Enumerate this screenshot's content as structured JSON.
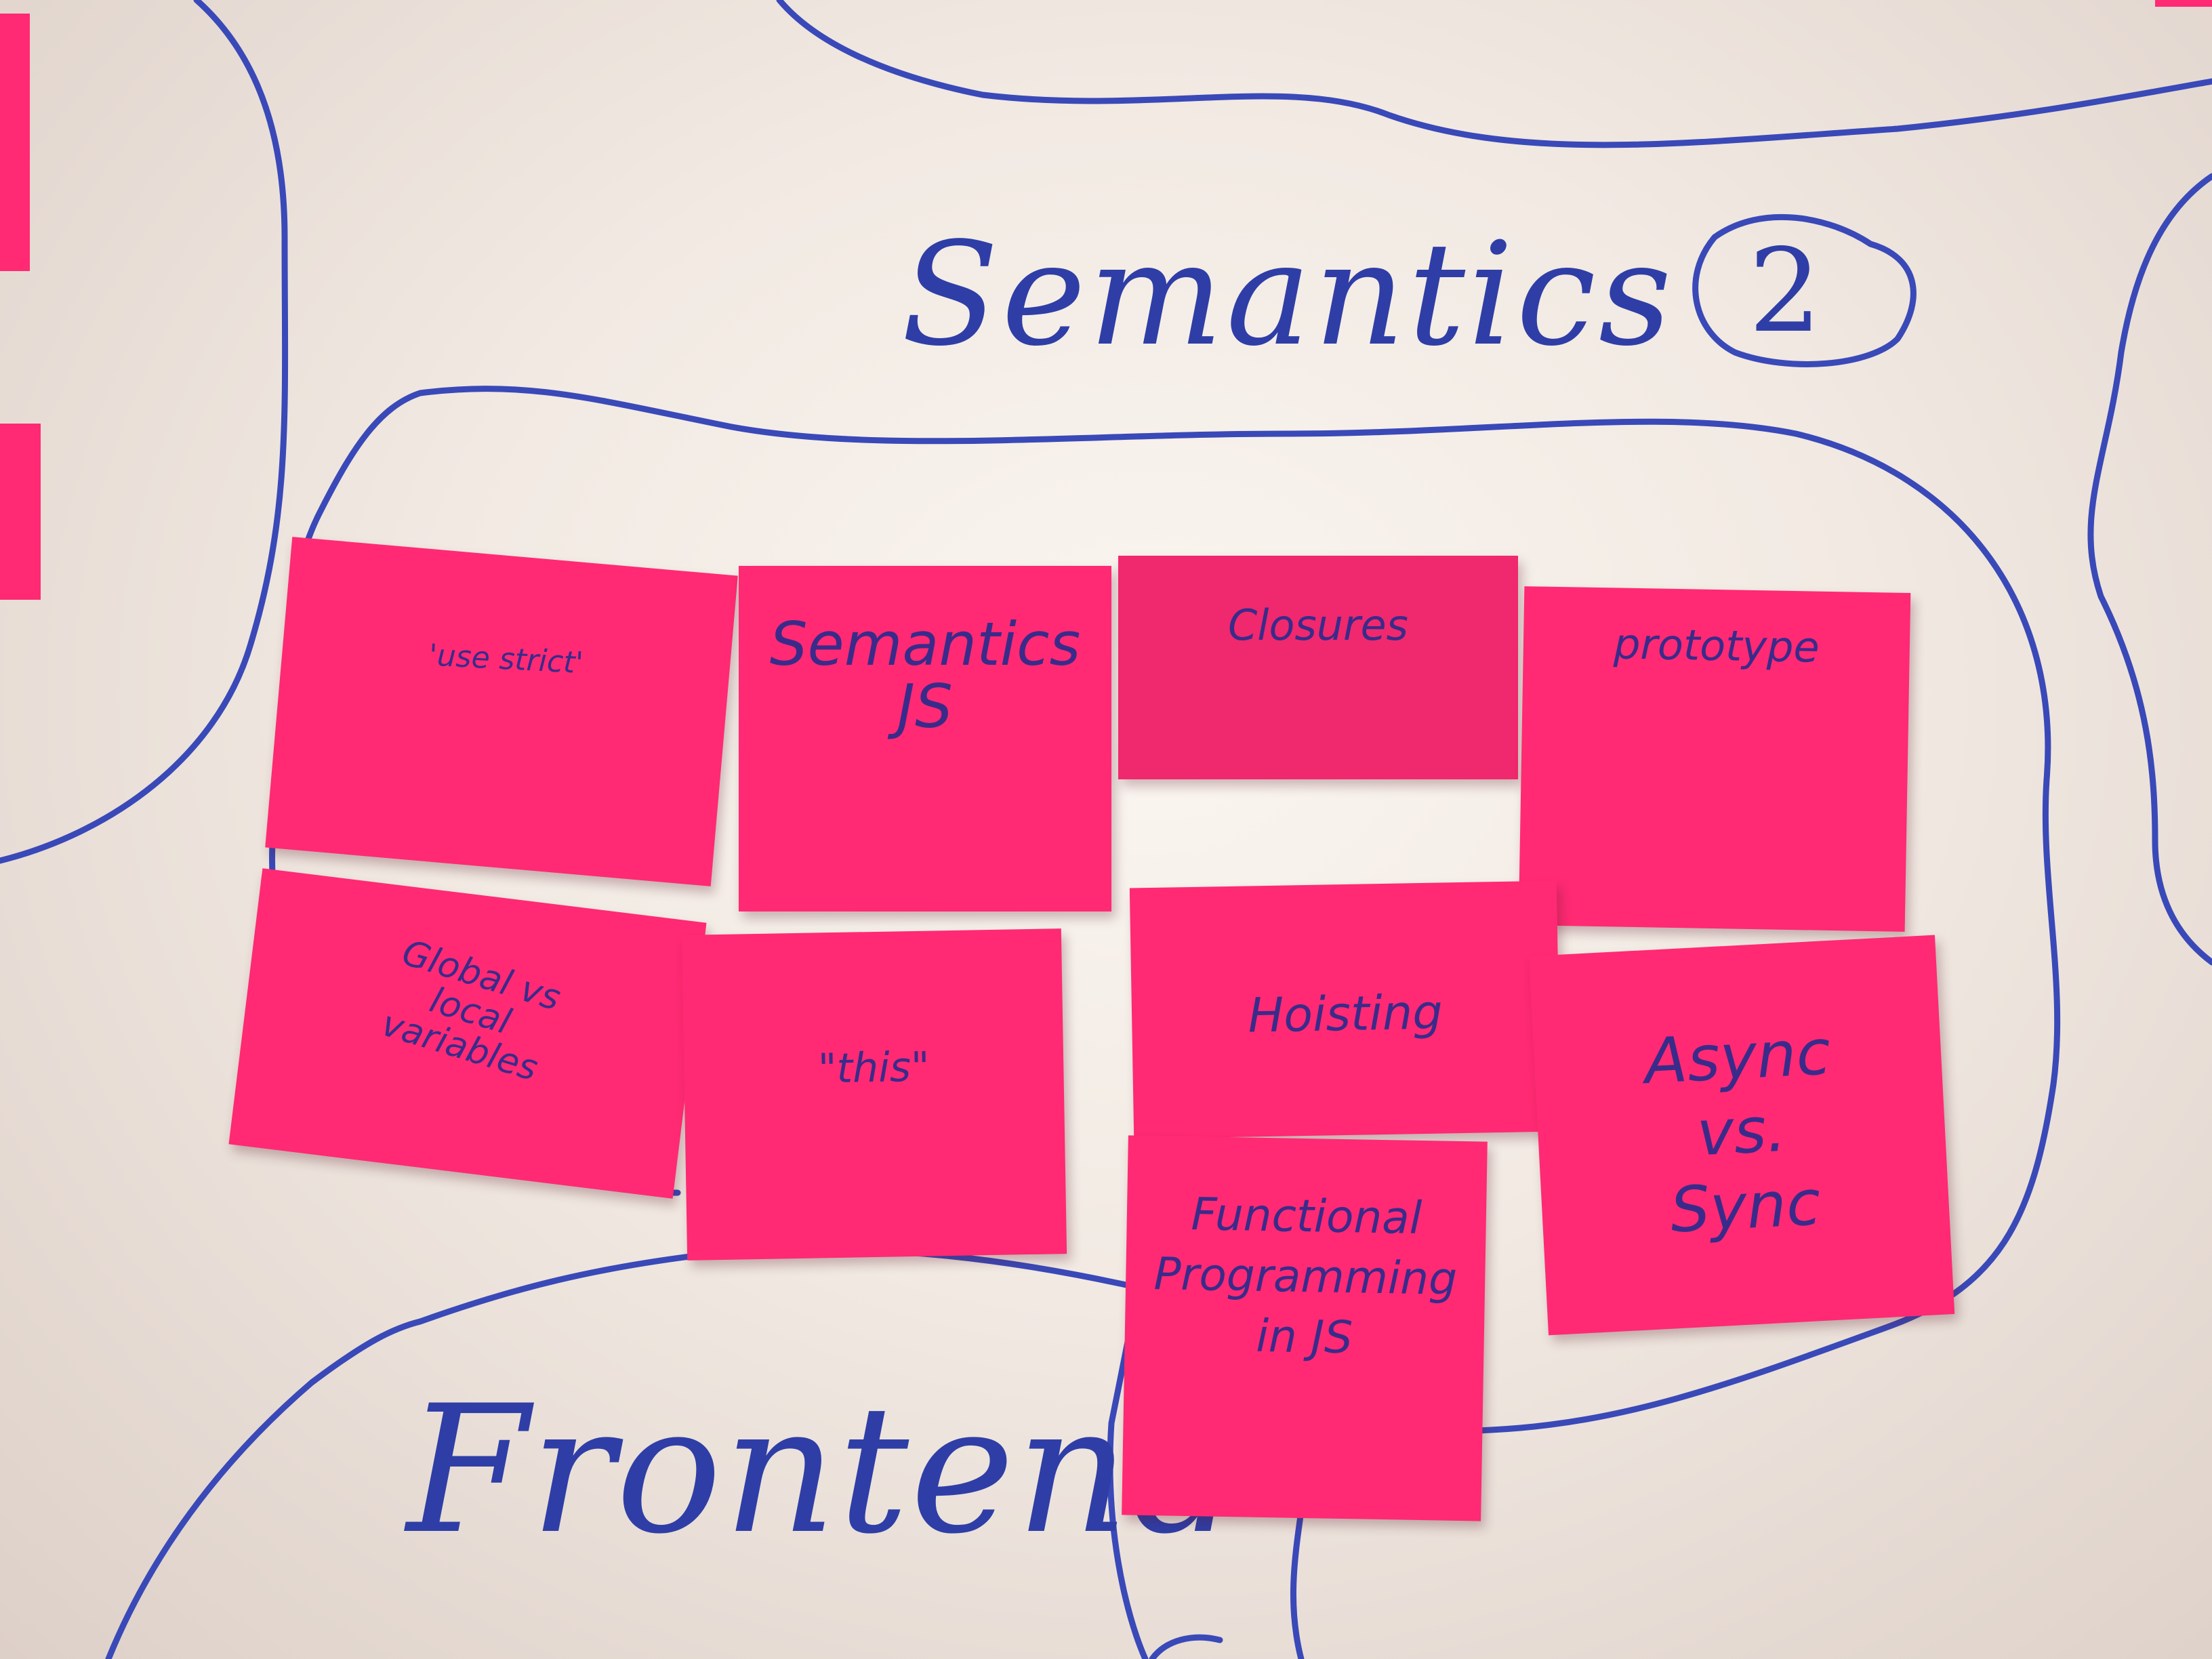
{
  "board": {
    "heading": "Semantics",
    "heading_badge": "2",
    "lower_heading": "Frontend",
    "ink_color": "#3a49b8",
    "note_color": "#ff2a73"
  },
  "notes": [
    {
      "text": "'use strict'"
    },
    {
      "text": "Semantics\nJS"
    },
    {
      "text": "Closures"
    },
    {
      "text": "prototype"
    },
    {
      "text": "Global vs\nlocal\nvariables"
    },
    {
      "text": "\"this\""
    },
    {
      "text": "Hoisting"
    },
    {
      "text": "Async\nvs.\nSync"
    },
    {
      "text": "Functional\nProgramming\nin JS"
    }
  ]
}
